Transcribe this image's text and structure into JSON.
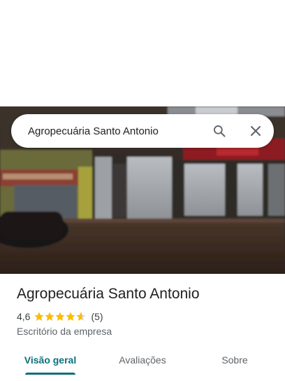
{
  "search": {
    "query": "Agropecuária Santo Antonio"
  },
  "place": {
    "name": "Agropecuária Santo Antonio",
    "rating": "4,6",
    "rating_value": 4.6,
    "rating_max": 5,
    "review_count": "(5)",
    "category": "Escritório da empresa"
  },
  "tabs": [
    {
      "label": "Visão geral",
      "active": true
    },
    {
      "label": "Avaliações",
      "active": false
    },
    {
      "label": "Sobre",
      "active": false
    }
  ],
  "colors": {
    "accent": "#0b6f7a",
    "star": "#fbbc04",
    "text_primary": "#202124",
    "text_secondary": "#5f6368"
  },
  "icons": {
    "search": "search-icon",
    "close": "close-icon",
    "star": "star-icon"
  }
}
